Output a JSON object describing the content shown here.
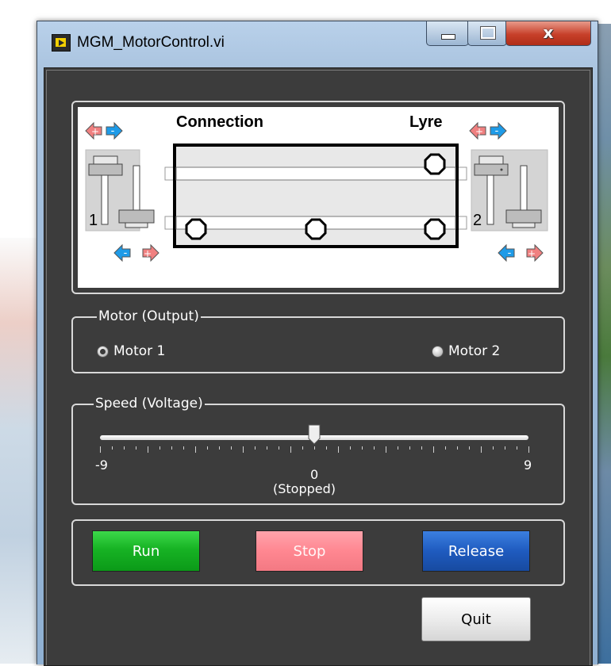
{
  "window": {
    "title": "MGM_MotorControl.vi",
    "close_glyph": "x"
  },
  "diagram": {
    "connection_label": "Connection",
    "lyre_label": "Lyre",
    "left_unit": "1",
    "right_unit": "2"
  },
  "motor_output": {
    "label": "Motor (Output)",
    "options": [
      {
        "label": "Motor 1",
        "selected": true
      },
      {
        "label": "Motor 2",
        "selected": false
      }
    ]
  },
  "speed": {
    "label": "Speed (Voltage)",
    "min_label": "-9",
    "zero_label": "0",
    "max_label": "9",
    "status": "(Stopped)",
    "min": -9,
    "max": 9,
    "value": 0
  },
  "buttons": {
    "run": "Run",
    "stop": "Stop",
    "release": "Release",
    "quit": "Quit"
  },
  "colors": {
    "panel_bg": "#3c3c3c",
    "run": "#17b324",
    "stop": "#ff8791",
    "release": "#1f5bbf",
    "arrow_red": "#f08080",
    "arrow_blue": "#1e9be8"
  }
}
